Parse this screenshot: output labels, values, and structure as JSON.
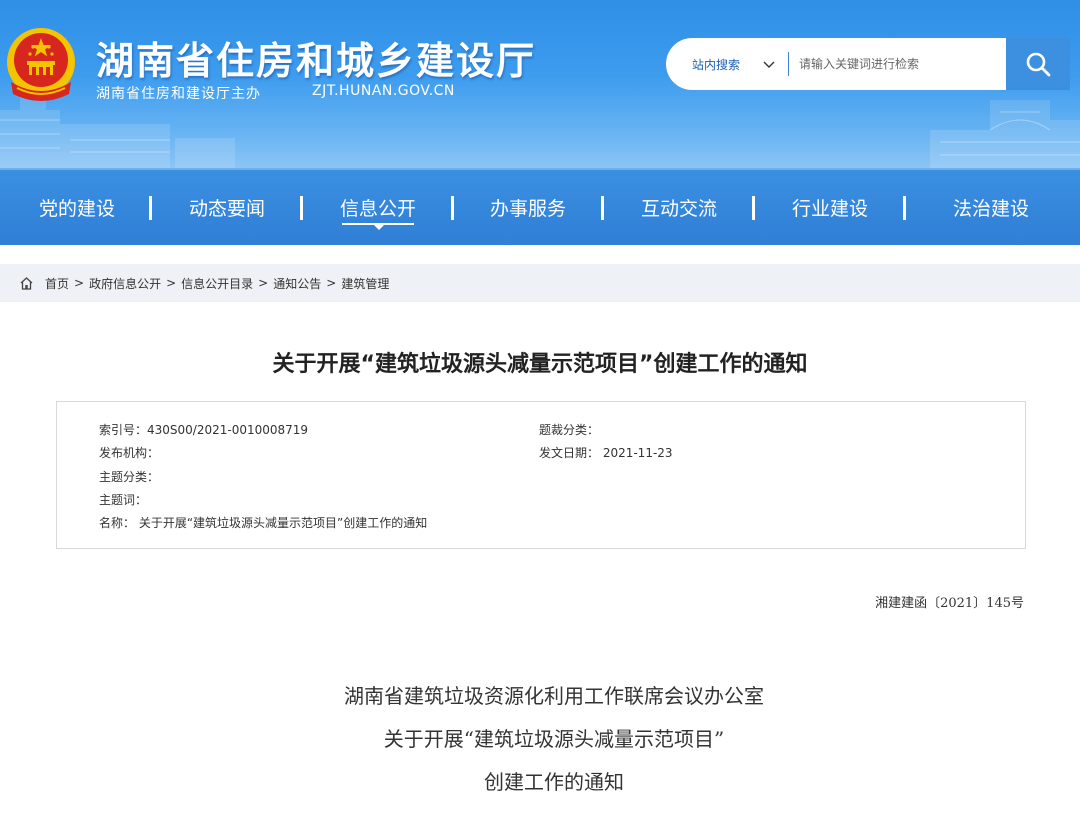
{
  "header": {
    "site_title": "湖南省住房和城乡建设厅",
    "site_subtitle": "湖南省住房和建设厅主办",
    "site_domain": "ZJT.HUNAN.GOV.CN",
    "search": {
      "scope_label": "站内搜索",
      "placeholder": "请输入关键词进行检索"
    }
  },
  "nav": {
    "items": [
      {
        "label": "党的建设"
      },
      {
        "label": "动态要闻"
      },
      {
        "label": "信息公开",
        "active": true
      },
      {
        "label": "办事服务"
      },
      {
        "label": "互动交流"
      },
      {
        "label": "行业建设"
      },
      {
        "label": "法治建设"
      }
    ]
  },
  "breadcrumb": [
    "首页",
    "政府信息公开",
    "信息公开目录",
    "通知公告",
    "建筑管理"
  ],
  "article": {
    "title": "关于开展“建筑垃圾源头减量示范项目”创建工作的通知",
    "meta": {
      "index_no": "索引号：430S00/2021-0010008719",
      "publisher": "发布机构：",
      "topic_category": "主题分类：",
      "keywords": "主题词：",
      "name": "名称： 关于开展“建筑垃圾源头减量示范项目”创建工作的通知",
      "genre_category": "题裁分类：",
      "issue_date": "发文日期： 2021-11-23"
    },
    "doc_number": "湘建建函〔2021〕145号",
    "body_heading": [
      "湖南省建筑垃圾资源化利用工作联席会议办公室",
      "关于开展“建筑垃圾源头减量示范项目”",
      "创建工作的通知"
    ]
  },
  "colors": {
    "header_blue": "#3d9cee",
    "nav_blue": "#2f7fd6",
    "emblem_red": "#d7261e",
    "emblem_gold": "#f5c400",
    "breadcrumb_bg": "#eef1f5"
  },
  "icons": [
    "national-emblem-icon",
    "chevron-down-icon",
    "search-icon",
    "home-icon",
    "nav-caret-icon"
  ]
}
